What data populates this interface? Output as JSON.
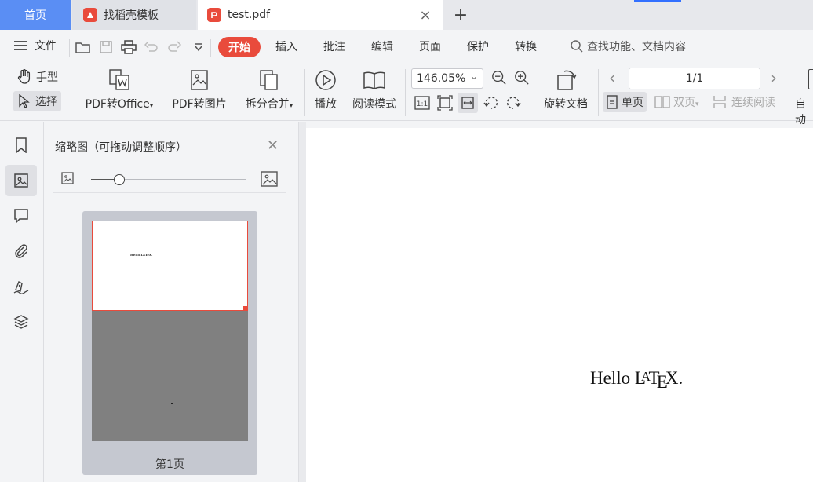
{
  "tabs": {
    "home_label": "首页",
    "template_label": "找稻壳模板",
    "pdf_label": "test.pdf",
    "close_glyph": "×",
    "add_glyph": "+"
  },
  "menu": {
    "file_label": "文件",
    "items": [
      "开始",
      "插入",
      "批注",
      "编辑",
      "页面",
      "保护",
      "转换"
    ],
    "search_placeholder": "查找功能、文档内容"
  },
  "ribbon": {
    "hand_label": "手型",
    "select_label": "选择",
    "pdf_to_office_label": "PDF转Office",
    "pdf_to_image_label": "PDF转图片",
    "split_merge_label": "拆分合并",
    "play_label": "播放",
    "read_mode_label": "阅读模式",
    "zoom_value": "146.05%",
    "actual_size_label": "1:1",
    "rotate_doc_label": "旋转文档",
    "page_indicator": "1/1",
    "single_page_label": "单页",
    "double_page_label": "双页",
    "continuous_label": "连续阅读",
    "auto_label": "自动"
  },
  "thumbnail_panel": {
    "title": "缩略图（可拖动调整顺序）",
    "slider_value": 0.18,
    "pages": [
      {
        "label": "第1页",
        "content": "Hello LaTeX."
      }
    ]
  },
  "document": {
    "text_prefix": "Hello ",
    "latex_L": "L",
    "latex_A": "A",
    "latex_T": "T",
    "latex_E": "E",
    "latex_X": "X",
    "text_suffix": "."
  },
  "colors": {
    "accent_blue": "#5a8ef4",
    "start_red": "#e94b3c",
    "page_gray": "#808080"
  }
}
